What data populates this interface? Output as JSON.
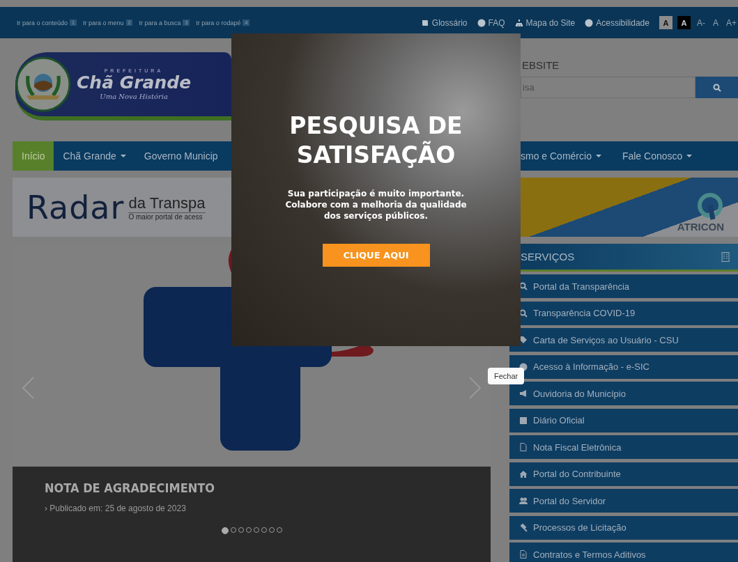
{
  "top_bar": {
    "skip_links": [
      {
        "label": "Ir para o conteúdo",
        "key": "1"
      },
      {
        "label": "Ir para o menu",
        "key": "2"
      },
      {
        "label": "Ir para a busca",
        "key": "3"
      },
      {
        "label": "Ir para o rodapé",
        "key": "4"
      }
    ],
    "links": [
      "Glossário",
      "FAQ",
      "Mapa do Site",
      "Acessibilidade"
    ],
    "contrast_buttons": [
      {
        "label": "A",
        "kind": "light"
      },
      {
        "label": "A",
        "kind": "dark"
      }
    ],
    "font_size_buttons": [
      "A-",
      "A",
      "A+"
    ]
  },
  "header": {
    "logo": {
      "overline": "PREFEITURA",
      "name": "Chã Grande",
      "tagline": "Uma Nova História"
    },
    "search": {
      "heading": "EBSITE",
      "placeholder": "isa"
    }
  },
  "nav": [
    {
      "label": "Início",
      "selected": true,
      "dropdown": false
    },
    {
      "label": "Chã Grande",
      "selected": false,
      "dropdown": true
    },
    {
      "label": "Governo Municip",
      "selected": false,
      "dropdown": false
    },
    {
      "label": "smo e Comércio",
      "selected": false,
      "dropdown": true
    },
    {
      "label": "Fale Conosco",
      "selected": false,
      "dropdown": true
    }
  ],
  "banners": {
    "radar": {
      "word": "Radar",
      "title": "da Transpa",
      "subtitle": "O maior portal de acess"
    },
    "atricon": {
      "label": "ATRICON"
    }
  },
  "carousel": {
    "title": "NOTA DE AGRADECIMENTO",
    "date": "› Publicado em: 25 de agosto de 2023",
    "dots": [
      {
        "selected": true
      },
      {
        "selected": false
      },
      {
        "selected": false
      },
      {
        "selected": false
      },
      {
        "selected": false
      },
      {
        "selected": false
      },
      {
        "selected": false
      },
      {
        "selected": false
      }
    ]
  },
  "sidebar": {
    "title": "SERVIÇOS",
    "items": [
      "Portal da Transparência",
      "Transparência COVID-19",
      "Carta de Serviços ao Usuário - CSU",
      "Acesso à Informação - e-SIC",
      "Ouvidoria do Município",
      "Diário Oficial",
      "Nota Fiscal Eletrônica",
      "Portal do Contribuinte",
      "Portal do Servidor",
      "Processos de Licitação",
      "Contratos e Termos Aditivos"
    ]
  },
  "modal": {
    "title": "PESQUISA DE SATISFAÇÃO",
    "text_lines": [
      "Sua participação é muito importante.",
      "Colabore com a melhoria da qualidade",
      "dos serviços públicos."
    ],
    "button": "CLIQUE AQUI"
  },
  "tooltip": "Fechar"
}
